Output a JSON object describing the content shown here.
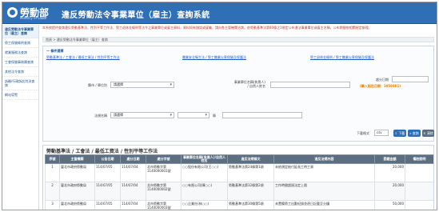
{
  "header": {
    "logo_text": "勞動部",
    "logo_sub": "Ministry of Labor",
    "site_title": "違反勞動法令事業單位（雇主）查詢系統"
  },
  "sidebar": {
    "items": [
      {
        "label": "違反勞動法令事業單位（雇主）查詢"
      },
      {
        "label": "勞工保險條例查詢"
      },
      {
        "label": "就業服務法查詢"
      },
      {
        "label": "工會保險事務類查詢"
      },
      {
        "label": "其他法令查詢"
      },
      {
        "label": "訴願/行政訴訟判決查詢"
      },
      {
        "label": "網站導覽"
      }
    ]
  },
  "notice": "本系統提供查詢違反勞動基準法、性別平等工作法、勞工退休金條例等法令之事業單位或雇主資料，資料如有錯誤或疑義，請向各主管機關洽詢。依勞動基準法第80條之1規定公布違法事業單位或雇主名稱，公布期間依相關規定辦理。",
  "breadcrumb": "首頁 > 違反勞動法令事業單位（雇主）查詢",
  "search": {
    "panel_title": "一 條件選擇",
    "links": [
      "勞動基準法 / 工會法 / 最低工資法 / 性別平等工作法",
      "職業安全衛生法 / 勞工職業災害保險及保護法",
      "勞工退休金條例 / 勞工職業災害保險及保護法"
    ],
    "region_label": "縣市 / 單位別",
    "region_value": "請選擇",
    "name_label": "事業單位名稱(負責人)\n/ 自然人姓名",
    "name_placeholder": "",
    "date_label": "處分日期",
    "date_start": "",
    "hint": "(輸入起迄日期：1050101)",
    "law_label": "法規名稱",
    "law_value": "請選擇",
    "article_label": "條",
    "article_value": "",
    "pagesize_label": "下載格式",
    "pagesize_value": "csv",
    "download_label": "下載",
    "query_label": "查詢",
    "clear_label": "清除"
  },
  "results": {
    "title": "勞動基準法 / 工會法 / 最低工資法 / 性別平等工作法",
    "columns": [
      "序號",
      "主管機關",
      "公告日期",
      "處分日期",
      "處分字號",
      "事業單位名稱(負責人)/自然人姓名",
      "違反法規條文",
      "違反法規內容",
      "罰鍰金額",
      "備註說明"
    ],
    "rows": [
      {
        "no": "1",
        "authority": "臺北市政府勞動局",
        "pub_date": "114/07/05",
        "pen_date": "114/07/04",
        "doc_no": "北市勞動字第1140000001號",
        "company": "○○股份有限公司(王○○)",
        "article": "勞動基準法第24條第1項",
        "content": "未依規定給付延長工時工資",
        "amount": "20,000",
        "remark": ""
      },
      {
        "no": "2",
        "authority": "臺北市政府勞動局",
        "pub_date": "114/07/05",
        "pen_date": "114/07/04",
        "doc_no": "北市勞動字第1140000002號",
        "company": "○○有限公司(陳○○)",
        "article": "勞動基準法第32條第2項",
        "content": "工作時間超過法定上限",
        "amount": "20,000",
        "remark": ""
      },
      {
        "no": "3",
        "authority": "臺北市政府勞動局",
        "pub_date": "114/07/05",
        "pen_date": "114/07/04",
        "doc_no": "北市勞動字第1140000003號",
        "company": "○○企業社(林○○)",
        "article": "勞動基準法第30條第5項",
        "content": "未置備勞工出勤紀錄並逐日記載至分鐘",
        "amount": "50,000",
        "remark": ""
      }
    ]
  },
  "colors": {
    "brand": "#2f6fb5",
    "table_header": "#5c6f82",
    "notice": "#c0392b",
    "hint": "#e08000"
  }
}
